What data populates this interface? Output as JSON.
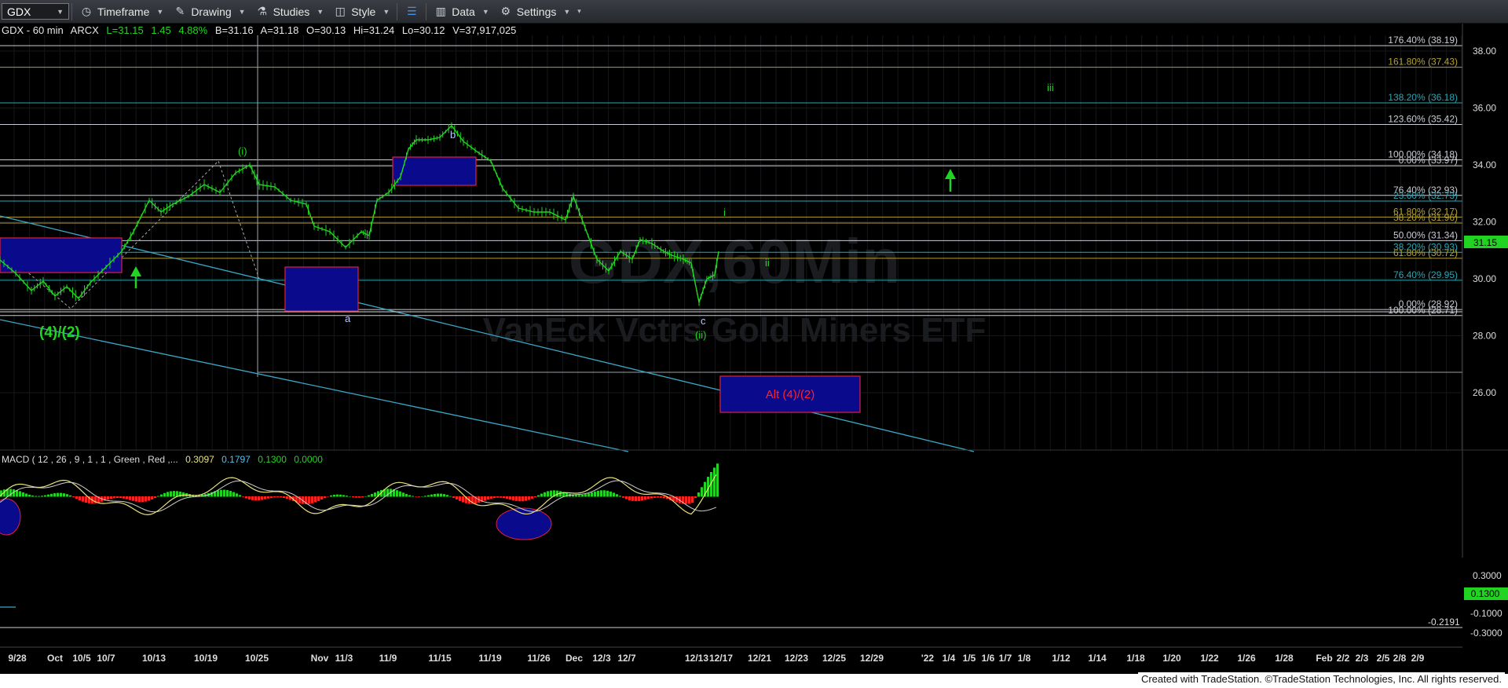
{
  "toolbar": {
    "symbol": "GDX",
    "timeframe_label": "Timeframe",
    "drawing_label": "Drawing",
    "studies_label": "Studies",
    "style_label": "Style",
    "data_label": "Data",
    "settings_label": "Settings"
  },
  "info_bar": {
    "title": "GDX - 60 min",
    "exchange": "ARCX",
    "last": "L=31.15",
    "change": "1.45",
    "change_pct": "4.88%",
    "bid": "B=31.16",
    "ask": "A=31.18",
    "open": "O=30.13",
    "high": "Hi=31.24",
    "low": "Lo=30.12",
    "volume": "V=37,917,025"
  },
  "watermark": {
    "symbol": "GDX,60Min",
    "name": "VanEck Vctrs Gold Miners ETF"
  },
  "price_axis": {
    "ticks": [
      "38.00",
      "36.00",
      "34.00",
      "32.00",
      "30.00",
      "28.00",
      "26.00"
    ],
    "current_price": "31.15"
  },
  "fib_levels": [
    {
      "label": "176.40% (38.19)",
      "price": 38.19,
      "color": "#c9ccd3"
    },
    {
      "label": "161.80% (37.43)",
      "price": 37.43,
      "color": "#b5a030"
    },
    {
      "label": "138.20% (36.18)",
      "price": 36.18,
      "color": "#2aa7b3"
    },
    {
      "label": "123.60% (35.42)",
      "price": 35.42,
      "color": "#c9ccd3"
    },
    {
      "label": "100.00% (34.18)",
      "price": 34.18,
      "color": "#c9ccd3"
    },
    {
      "label": "0.00% (33.97)",
      "price": 33.97,
      "color": "#c9ccd3"
    },
    {
      "label": "76.40% (32.93)",
      "price": 32.93,
      "color": "#c9ccd3"
    },
    {
      "label": "23.60% (32.73)",
      "price": 32.73,
      "color": "#2aa7b3"
    },
    {
      "label": "61.80% (32.17)",
      "price": 32.17,
      "color": "#b5a030"
    },
    {
      "label": "38.20% (31.96)",
      "price": 31.96,
      "color": "#b5a030"
    },
    {
      "label": "50.00% (31.34)",
      "price": 31.34,
      "color": "#c9ccd3"
    },
    {
      "label": "38.20% (30.93)",
      "price": 30.93,
      "color": "#2aa7b3"
    },
    {
      "label": "61.80% (30.72)",
      "price": 30.72,
      "color": "#b5a030"
    },
    {
      "label": "76.40% (29.95)",
      "price": 29.95,
      "color": "#2aa7b3"
    },
    {
      "label": "0.00% (28.92)",
      "price": 28.92,
      "color": "#c9ccd3"
    },
    {
      "label": "100.00% (28.71)",
      "price": 28.71,
      "color": "#c9ccd3"
    }
  ],
  "wave_labels": {
    "four_two": "(4)/(2)",
    "wave_i_paren": "(i)",
    "wave_a": "a",
    "wave_b": "b",
    "wave_c": "c",
    "wave_ii_paren": "(ii)",
    "wave_i": "i",
    "wave_ii": "ii",
    "wave_iii": "iii",
    "alt_box": "Alt (4)/(2)"
  },
  "macd": {
    "title": "MACD ( 12 , 26 , 9 , 1 , 1 , Green , Red ,...",
    "v1": "0.3097",
    "v2": "0.1797",
    "v3": "0.1300",
    "v4": "0.0000",
    "axis_ticks": [
      "0.3000",
      "-0.1000",
      "-0.3000"
    ],
    "current": "0.1300",
    "level": "-0.2191"
  },
  "time_axis": [
    "9/28",
    "Oct",
    "10/5",
    "10/7",
    "10/13",
    "10/19",
    "10/25",
    "Nov",
    "11/3",
    "11/9",
    "11/15",
    "11/19",
    "11/26",
    "Dec",
    "12/3",
    "12/7",
    "12/13",
    "12/17",
    "12/21",
    "12/23",
    "12/25",
    "12/29",
    "'22",
    "1/4",
    "1/5",
    "1/6",
    "1/7",
    "1/8",
    "1/12",
    "1/14",
    "1/18",
    "1/20",
    "1/22",
    "1/26",
    "1/28",
    "Feb",
    "2/2",
    "2/3",
    "2/5",
    "2/8",
    "2/9"
  ],
  "footer": "Created with TradeStation. ©TradeStation Technologies, Inc. All rights reserved.",
  "colors": {
    "price": "#22d422",
    "macd_line": "#e8e27a",
    "signal_line": "#bfbfbf",
    "hist_up": "#22d422",
    "hist_down": "#ff2020",
    "box_fill": "#0a0a8c",
    "box_border": "#e0203a",
    "trendline": "#3aa7c7"
  }
}
